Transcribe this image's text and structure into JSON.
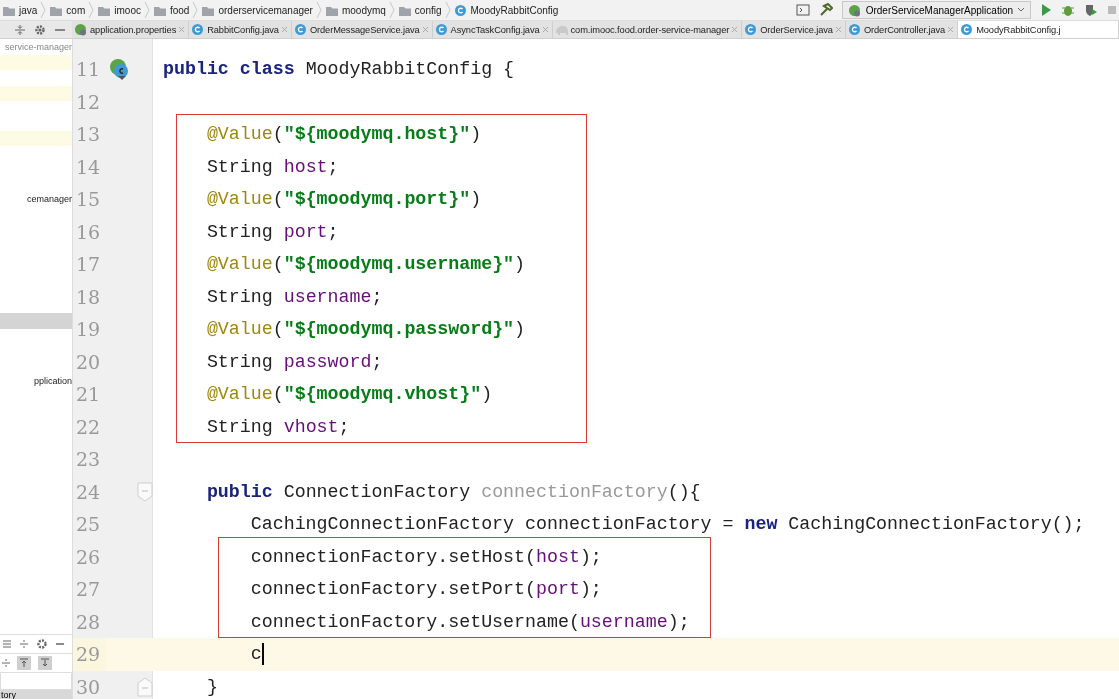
{
  "breadcrumbs": [
    {
      "label": "java",
      "kind": "folder"
    },
    {
      "label": "com",
      "kind": "folder"
    },
    {
      "label": "imooc",
      "kind": "folder"
    },
    {
      "label": "food",
      "kind": "folder"
    },
    {
      "label": "orderservicemanager",
      "kind": "folder"
    },
    {
      "label": "moodymq",
      "kind": "folder"
    },
    {
      "label": "config",
      "kind": "folder"
    },
    {
      "label": "MoodyRabbitConfig",
      "kind": "class"
    }
  ],
  "run_config": {
    "label": "OrderServiceManagerApplication"
  },
  "tabs": [
    {
      "label": "application.properties",
      "kind": "properties",
      "selected": false
    },
    {
      "label": "RabbitConfig.java",
      "kind": "class",
      "selected": false
    },
    {
      "label": "OrderMessageService.java",
      "kind": "class",
      "selected": false
    },
    {
      "label": "AsyncTaskConfig.java",
      "kind": "class",
      "selected": false
    },
    {
      "label": "com.imooc.food.order-service-manager",
      "kind": "module",
      "selected": false
    },
    {
      "label": "OrderService.java",
      "kind": "class",
      "selected": false
    },
    {
      "label": "OrderController.java",
      "kind": "class",
      "selected": false
    },
    {
      "label": "MoodyRabbitConfig.j",
      "kind": "class",
      "selected": true
    }
  ],
  "project_tree": [
    {
      "label": "service-manager",
      "highlighted": false,
      "selected": false
    },
    {
      "highlighted": true,
      "selected": false
    },
    {
      "highlighted": false,
      "selected": false
    },
    {
      "highlighted": true,
      "selected": false
    },
    {
      "highlighted": false,
      "selected": false
    },
    {
      "highlighted": false,
      "selected": false
    },
    {
      "highlighted": true,
      "selected": false
    },
    {
      "highlighted": false,
      "selected": false
    },
    {
      "highlighted": false,
      "selected": false
    },
    {
      "highlighted": false,
      "selected": false
    },
    {
      "label": "cemanager",
      "highlighted": false,
      "selected": false
    },
    {
      "highlighted": false,
      "selected": false
    },
    {
      "highlighted": false,
      "selected": false
    },
    {
      "highlighted": false,
      "selected": false
    },
    {
      "highlighted": false,
      "selected": false
    },
    {
      "highlighted": false,
      "selected": false
    },
    {
      "highlighted": false,
      "selected": false
    },
    {
      "highlighted": false,
      "selected": false
    },
    {
      "highlighted": false,
      "selected": true
    },
    {
      "highlighted": false,
      "selected": false
    },
    {
      "highlighted": false,
      "selected": false
    },
    {
      "highlighted": false,
      "selected": false
    },
    {
      "label": "pplication",
      "highlighted": false,
      "selected": false
    }
  ],
  "bottom_panel": {
    "title": "tory"
  },
  "code_blocks": [
    {
      "marked": false,
      "lines": [
        {
          "number": "11",
          "kind": "class_start",
          "current": false,
          "tokens": [
            {
              "text": "public class",
              "kind": "keyword"
            },
            {
              "text": " MoodyRabbitConfig {",
              "kind": "plain"
            }
          ]
        },
        {
          "number": "12",
          "kind": "plain",
          "current": false
        }
      ]
    },
    {
      "marked": true,
      "lines": [
        {
          "number": "13",
          "kind": "plain",
          "current": false,
          "tokens": [
            {
              "text": "    @Value",
              "kind": "annotation"
            },
            {
              "text": "(",
              "kind": "plain"
            },
            {
              "text": "\"${moodymq.host}\"",
              "kind": "string"
            },
            {
              "text": ")",
              "kind": "plain"
            }
          ]
        },
        {
          "number": "14",
          "kind": "plain",
          "current": false,
          "tokens": [
            {
              "text": "    String ",
              "kind": "plain"
            },
            {
              "text": "host",
              "kind": "field"
            },
            {
              "text": ";",
              "kind": "plain"
            }
          ]
        },
        {
          "number": "15",
          "kind": "plain",
          "current": false,
          "tokens": [
            {
              "text": "    @Value",
              "kind": "annotation"
            },
            {
              "text": "(",
              "kind": "plain"
            },
            {
              "text": "\"${moodymq.port}\"",
              "kind": "string"
            },
            {
              "text": ")",
              "kind": "plain"
            }
          ]
        },
        {
          "number": "16",
          "kind": "plain",
          "current": false,
          "tokens": [
            {
              "text": "    String ",
              "kind": "plain"
            },
            {
              "text": "port",
              "kind": "field"
            },
            {
              "text": ";",
              "kind": "plain"
            }
          ]
        },
        {
          "number": "17",
          "kind": "plain",
          "current": false,
          "tokens": [
            {
              "text": "    @Value",
              "kind": "annotation"
            },
            {
              "text": "(",
              "kind": "plain"
            },
            {
              "text": "\"${moodymq.username}\"",
              "kind": "string"
            },
            {
              "text": ")",
              "kind": "plain"
            }
          ]
        },
        {
          "number": "18",
          "kind": "plain",
          "current": false,
          "tokens": [
            {
              "text": "    String ",
              "kind": "plain"
            },
            {
              "text": "username",
              "kind": "field"
            },
            {
              "text": ";",
              "kind": "plain"
            }
          ]
        },
        {
          "number": "19",
          "kind": "plain",
          "current": false,
          "tokens": [
            {
              "text": "    @Value",
              "kind": "annotation"
            },
            {
              "text": "(",
              "kind": "plain"
            },
            {
              "text": "\"${moodymq.password}\"",
              "kind": "string"
            },
            {
              "text": ")",
              "kind": "plain"
            }
          ]
        },
        {
          "number": "20",
          "kind": "plain",
          "current": false,
          "tokens": [
            {
              "text": "    String ",
              "kind": "plain"
            },
            {
              "text": "password",
              "kind": "field"
            },
            {
              "text": ";",
              "kind": "plain"
            }
          ]
        },
        {
          "number": "21",
          "kind": "plain",
          "current": false,
          "tokens": [
            {
              "text": "    @Value",
              "kind": "annotation"
            },
            {
              "text": "(",
              "kind": "plain"
            },
            {
              "text": "\"${moodymq.vhost}\"",
              "kind": "string"
            },
            {
              "text": ")",
              "kind": "plain"
            }
          ]
        },
        {
          "number": "22",
          "kind": "plain",
          "current": false,
          "tokens": [
            {
              "text": "    String ",
              "kind": "plain"
            },
            {
              "text": "vhost",
              "kind": "field"
            },
            {
              "text": ";",
              "kind": "plain"
            }
          ]
        }
      ]
    },
    {
      "marked": false,
      "lines": [
        {
          "number": "23",
          "kind": "plain",
          "current": false
        },
        {
          "number": "24",
          "kind": "fold_start",
          "current": false,
          "tokens": [
            {
              "text": "    public",
              "kind": "keyword"
            },
            {
              "text": " ConnectionFactory ",
              "kind": "plain"
            },
            {
              "text": "connectionFactory",
              "kind": "unused"
            },
            {
              "text": "(){",
              "kind": "plain"
            }
          ]
        },
        {
          "number": "25",
          "kind": "plain",
          "current": false,
          "tokens": [
            {
              "text": "        CachingConnectionFactory connectionFactory = ",
              "kind": "plain"
            },
            {
              "text": "new",
              "kind": "keyword"
            },
            {
              "text": " CachingConnectionFactory();",
              "kind": "plain"
            }
          ]
        }
      ]
    },
    {
      "marked": true,
      "lines": [
        {
          "number": "26",
          "kind": "plain",
          "current": false,
          "tokens": [
            {
              "text": "        connectionFactory.setHost(",
              "kind": "plain"
            },
            {
              "text": "host",
              "kind": "field"
            },
            {
              "text": ");",
              "kind": "plain"
            }
          ]
        },
        {
          "number": "27",
          "kind": "plain",
          "current": false,
          "tokens": [
            {
              "text": "        connectionFactory.setPort(",
              "kind": "plain"
            },
            {
              "text": "port",
              "kind": "field"
            },
            {
              "text": ");",
              "kind": "plain"
            }
          ]
        },
        {
          "number": "28",
          "kind": "plain",
          "current": false,
          "tokens": [
            {
              "text": "        connectionFactory.setUsername(",
              "kind": "plain"
            },
            {
              "text": "username",
              "kind": "field"
            },
            {
              "text": ");",
              "kind": "plain"
            }
          ]
        }
      ]
    },
    {
      "marked": false,
      "lines": [
        {
          "number": "29",
          "kind": "plain",
          "current": true,
          "tokens": [
            {
              "text": "        c",
              "kind": "plain"
            }
          ]
        },
        {
          "number": "30",
          "kind": "fold_end",
          "current": false,
          "tokens": [
            {
              "text": "    }",
              "kind": "plain"
            }
          ]
        }
      ]
    }
  ]
}
